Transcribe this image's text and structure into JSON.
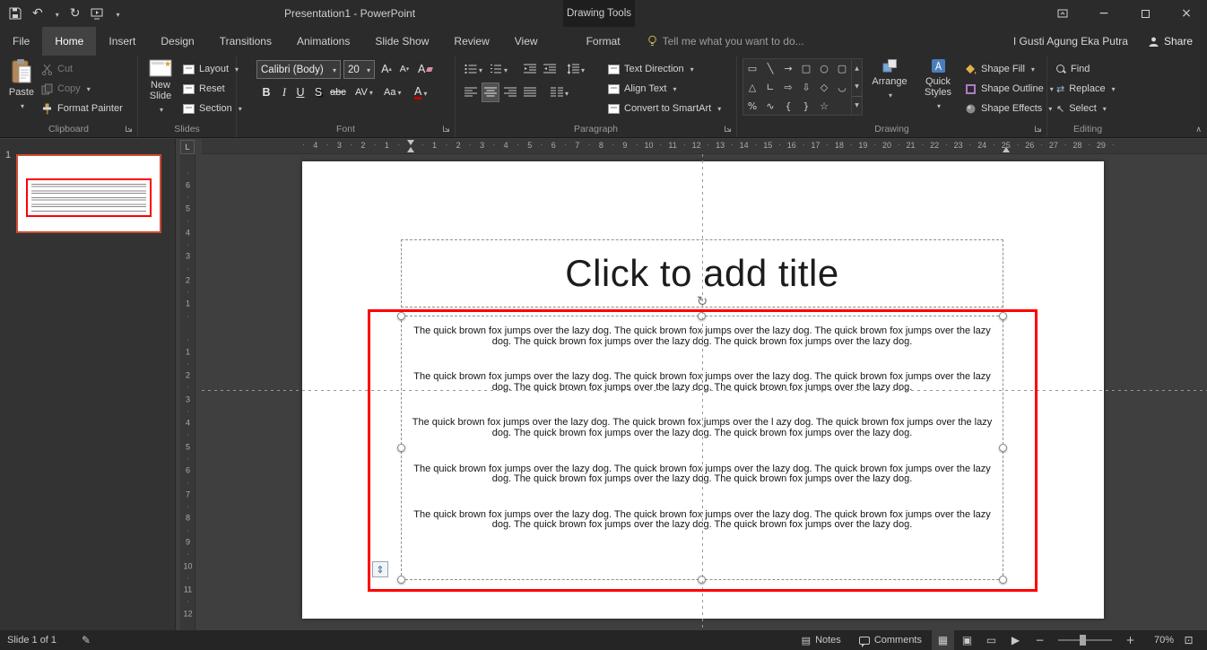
{
  "colors": {
    "selection_red": "#fe0000",
    "thumbnail_border": "#cf4b32",
    "font_color_bar": "#c00000",
    "accent": "#ed6c47"
  },
  "titlebar": {
    "title": "Presentation1 - PowerPoint",
    "context_group": "Drawing Tools"
  },
  "tabs": [
    {
      "label": "File"
    },
    {
      "label": "Home",
      "active": true
    },
    {
      "label": "Insert"
    },
    {
      "label": "Design"
    },
    {
      "label": "Transitions"
    },
    {
      "label": "Animations"
    },
    {
      "label": "Slide Show"
    },
    {
      "label": "Review"
    },
    {
      "label": "View"
    },
    {
      "label": "Format",
      "contextual": true
    }
  ],
  "tellme": {
    "label": "Tell me what you want to do..."
  },
  "account": {
    "user": "I Gusti Agung Eka Putra",
    "share": "Share"
  },
  "ribbon": {
    "clipboard": {
      "label": "Clipboard",
      "paste": "Paste",
      "cut": "Cut",
      "copy": "Copy",
      "format_painter": "Format Painter"
    },
    "slides": {
      "label": "Slides",
      "new_slide": "New Slide",
      "layout": "Layout",
      "reset": "Reset",
      "section": "Section"
    },
    "font": {
      "label": "Font",
      "name": "Calibri (Body)",
      "size": "20",
      "bold": "B",
      "italic": "I",
      "underline": "U",
      "shadow": "S",
      "strikethrough": "abc",
      "char_spacing": "AV",
      "change_case": "Aa",
      "font_color": "A",
      "grow": "A",
      "shrink": "A",
      "clear": "A"
    },
    "paragraph": {
      "label": "Paragraph",
      "text_direction": "Text Direction",
      "align_text": "Align Text",
      "smartart": "Convert to SmartArt"
    },
    "drawing": {
      "label": "Drawing",
      "arrange": "Arrange",
      "quick_styles": "Quick Styles",
      "shape_fill": "Shape Fill",
      "shape_outline": "Shape Outline",
      "shape_effects": "Shape Effects"
    },
    "editing": {
      "label": "Editing",
      "find": "Find",
      "replace": "Replace",
      "select": "Select"
    }
  },
  "drawing_shapes": [
    {
      "name": "rectangle",
      "glyph": "▭"
    },
    {
      "name": "line",
      "glyph": "╲"
    },
    {
      "name": "line-arrow",
      "glyph": "→"
    },
    {
      "name": "square",
      "glyph": "□"
    },
    {
      "name": "oval",
      "glyph": "○"
    },
    {
      "name": "rounded-rectangle",
      "glyph": "▢"
    },
    {
      "name": "triangle",
      "glyph": "△"
    },
    {
      "name": "right-angle",
      "glyph": "∟"
    },
    {
      "name": "block-arrow-right",
      "glyph": "⇨"
    },
    {
      "name": "block-arrow-down",
      "glyph": "⇩"
    },
    {
      "name": "diamond",
      "glyph": "◇"
    },
    {
      "name": "arc",
      "glyph": "◡"
    },
    {
      "name": "percent",
      "glyph": "%"
    },
    {
      "name": "curve",
      "glyph": "∿"
    },
    {
      "name": "brace-left",
      "glyph": "{"
    },
    {
      "name": "brace-right",
      "glyph": "}"
    },
    {
      "name": "star",
      "glyph": "☆"
    }
  ],
  "ruler": {
    "tab_selector": "L",
    "h_left": [
      "4",
      "3",
      "2",
      "1"
    ],
    "h_right": [
      "1",
      "2",
      "3",
      "4",
      "5",
      "6",
      "7",
      "8",
      "9",
      "10",
      "11",
      "12",
      "13",
      "14",
      "15",
      "16",
      "17",
      "18",
      "19",
      "20",
      "21",
      "22",
      "23",
      "24",
      "25",
      "26",
      "27",
      "28",
      "29"
    ],
    "v_top": [
      "6",
      "5",
      "4",
      "3",
      "2",
      "1"
    ],
    "v_bottom": [
      "1",
      "2",
      "3",
      "4",
      "5",
      "6",
      "7",
      "8",
      "9",
      "10",
      "11",
      "12"
    ]
  },
  "slide_panel": {
    "slide_number": "1"
  },
  "slide": {
    "title_placeholder": "Click to add title",
    "body_paragraphs": [
      "The quick brown fox jumps over the lazy dog. The quick brown fox jumps over the lazy dog. The quick brown fox jumps over the lazy dog. The quick brown fox jumps over the lazy dog. The quick brown fox jumps over the lazy dog.",
      "The quick brown fox jumps over the lazy dog. The quick brown fox jumps over the lazy dog. The quick brown fox jumps over the lazy dog. The quick brown fox jumps over the lazy dog. The quick brown fox jumps over the lazy dog.",
      "The quick brown fox jumps over the lazy dog. The quick brown fox jumps over the l azy dog. The quick brown fox jumps over the lazy dog. The quick brown fox jumps over the lazy dog. The quick brown fox jumps over the lazy dog.",
      "The quick brown fox jumps over the lazy dog. The quick brown fox jumps over the lazy dog. The quick brown fox jumps over the lazy dog. The quick brown fox jumps over the lazy dog. The quick brown fox jumps over the lazy dog.",
      "The quick brown fox jumps over the lazy dog. The quick brown fox jumps over the lazy dog. The quick brown fox jumps over the lazy dog. The quick brown fox jumps over the lazy dog. The quick brown fox jumps over the lazy dog."
    ]
  },
  "statusbar": {
    "slide_indicator": "Slide 1 of 1",
    "notes": "Notes",
    "comments": "Comments",
    "zoom": "70%"
  },
  "icons": {
    "undo": "↶",
    "repeat": "↻",
    "rotate_handle": "↻",
    "autofit": "⇕",
    "proofing": "✎",
    "notes": "▤",
    "view_normal": "▦",
    "view_sorter": "▣",
    "view_reading": "▭",
    "view_slideshow": "▶",
    "zoom_out": "−",
    "zoom_in": "+",
    "fit_to_window": "⊡",
    "minimize": "−",
    "close": "×",
    "collapse_ribbon": "∧",
    "select_arrow": "↖",
    "replace_arrows": "⇄",
    "gallery_up": "▲",
    "gallery_down": "▼",
    "gallery_more": "▼"
  }
}
